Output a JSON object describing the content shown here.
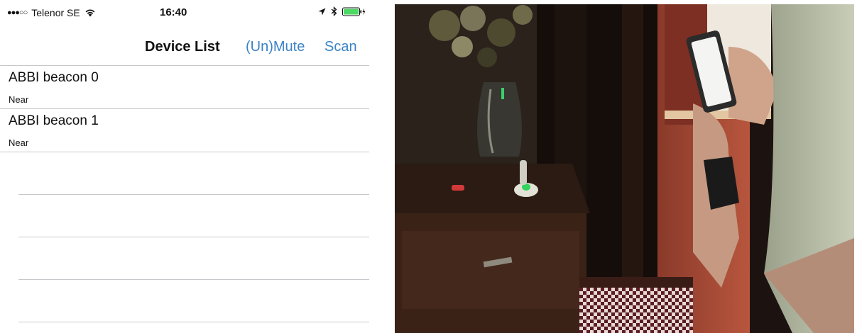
{
  "status_bar": {
    "signal": "●●●○○",
    "carrier": "Telenor SE",
    "time": "16:40",
    "icons": [
      "wifi-icon",
      "location-arrow-icon",
      "bluetooth-icon",
      "battery-charging-icon"
    ]
  },
  "nav": {
    "title": "Device List",
    "mute_label": "(Un)Mute",
    "scan_label": "Scan",
    "accent_color": "#3b82c4"
  },
  "devices": [
    {
      "name": "ABBI beacon 0",
      "proximity": "Near"
    },
    {
      "name": "ABBI beacon 1",
      "proximity": "Near"
    }
  ],
  "photo": {
    "subject": "person-holding-phone-near-beacon"
  }
}
